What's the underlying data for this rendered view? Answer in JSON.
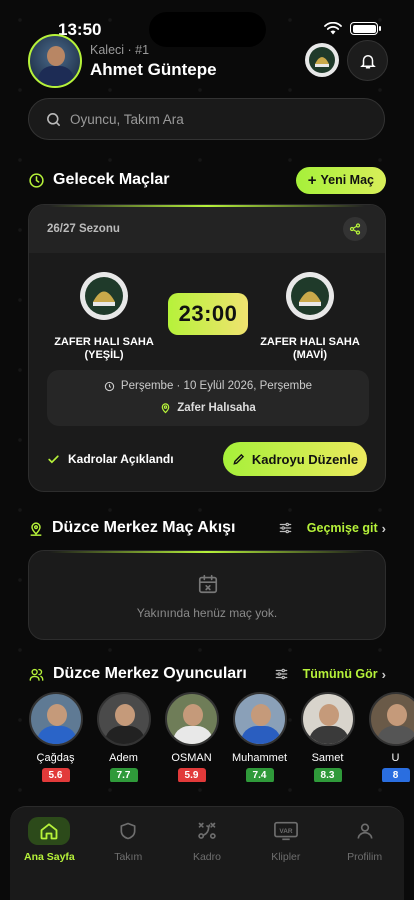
{
  "status_bar": {
    "time": "13:50"
  },
  "user": {
    "role": "Kaleci · #1",
    "name": "Ahmet Güntepe"
  },
  "search": {
    "placeholder": "Oyuncu, Takım Ara"
  },
  "upcoming": {
    "title": "Gelecek Maçlar",
    "new_label": "Yeni Maç",
    "season": "26/27 Sezonu",
    "home_team": "ZAFER HALI SAHA (YEŞİL)",
    "away_team": "ZAFER HALI SAHA (MAVİ)",
    "time": "23:00",
    "date": "Perşembe · 10 Eylül 2026, Perşembe",
    "venue": "Zafer Halısaha",
    "lineup_status": "Kadrolar Açıklandı",
    "edit_label": "Kadroyu Düzenle"
  },
  "feed": {
    "title": "Düzce Merkez Maç Akışı",
    "history_label": "Geçmişe git",
    "empty_text": "Yakınında henüz maç yok."
  },
  "players_section": {
    "title": "Düzce Merkez Oyuncuları",
    "see_all_label": "Tümünü Gör",
    "players": [
      {
        "name": "Çağdaş",
        "rating": "5.6",
        "rating_color": "#e23a3a",
        "kit_color": "#2a64c8"
      },
      {
        "name": "Adem",
        "rating": "7.7",
        "rating_color": "#2f9a3a",
        "kit_color": "#222222"
      },
      {
        "name": "OSMAN",
        "rating": "5.9",
        "rating_color": "#e23a3a",
        "kit_color": "#e8e8e8"
      },
      {
        "name": "Muhammet",
        "rating": "7.4",
        "rating_color": "#2f9a3a",
        "kit_color": "#2a5ec0"
      },
      {
        "name": "Samet",
        "rating": "8.3",
        "rating_color": "#2f9a3a",
        "kit_color": "#3a3a3a"
      },
      {
        "name": "U",
        "rating": "8",
        "rating_color": "#2a6ee0",
        "kit_color": "#555555"
      }
    ]
  },
  "nav": [
    {
      "label": "Ana Sayfa",
      "icon": "home-icon"
    },
    {
      "label": "Takım",
      "icon": "shield-icon"
    },
    {
      "label": "Kadro",
      "icon": "tactics-icon"
    },
    {
      "label": "Klipler",
      "icon": "var-icon"
    },
    {
      "label": "Profilim",
      "icon": "user-icon"
    }
  ],
  "colors": {
    "accent": "#b6f23a",
    "background": "#0a0a0a",
    "card": "#1b1b1b"
  }
}
